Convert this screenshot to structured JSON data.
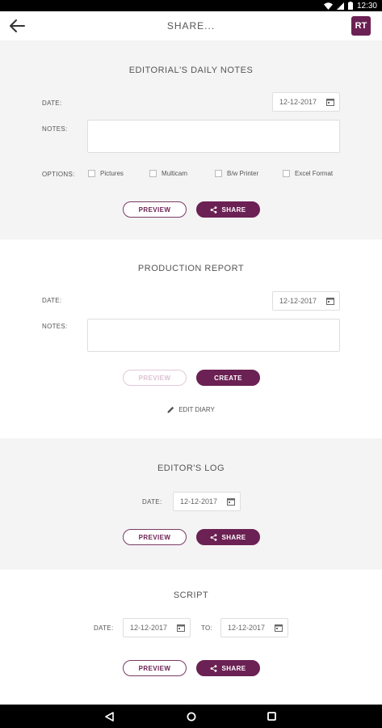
{
  "status_bar": {
    "time": "12:30"
  },
  "app_bar": {
    "title": "SHARE...",
    "logo_text": "RT"
  },
  "daily_notes": {
    "title": "EDITORIAL'S DAILY NOTES",
    "date_label": "DATE:",
    "date_value": "12-12-2017",
    "notes_label": "NOTES:",
    "options_label": "OPTIONS:",
    "options": [
      "Pictures",
      "Multicam",
      "B/w Printer",
      "Excel Format"
    ],
    "preview_label": "PREVIEW",
    "share_label": "SHARE"
  },
  "production_report": {
    "title": "PRODUCTION REPORT",
    "date_label": "DATE:",
    "date_value": "12-12-2017",
    "notes_label": "NOTES:",
    "preview_label": "PREVIEW",
    "create_label": "CREATE",
    "edit_diary_label": "EDIT DIARY"
  },
  "editors_log": {
    "title": "EDITOR'S LOG",
    "date_label": "DATE:",
    "date_value": "12-12-2017",
    "preview_label": "PREVIEW",
    "share_label": "SHARE"
  },
  "script": {
    "title": "SCRIPT",
    "date_label": "DATE:",
    "date_value": "12-12-2017",
    "to_label": "TO:",
    "to_value": "12-12-2017",
    "preview_label": "PREVIEW",
    "share_label": "SHARE"
  },
  "colors": {
    "accent": "#6b2153",
    "section_gray": "#f4f4f4"
  },
  "icons": [
    "back-arrow-icon",
    "calendar-icon",
    "share-icon",
    "pencil-icon",
    "nav-back-icon",
    "nav-home-icon",
    "nav-recents-icon"
  ]
}
